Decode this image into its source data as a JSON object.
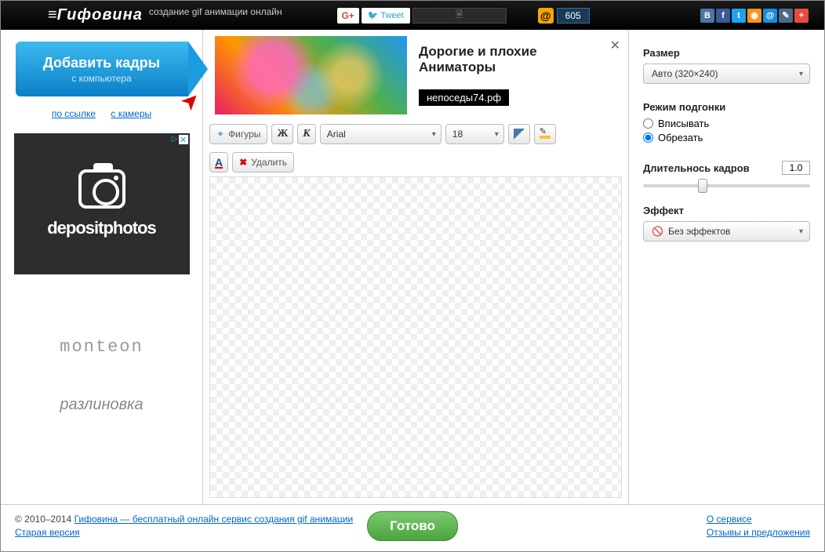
{
  "header": {
    "logo": "Гифовина",
    "tagline": "создание gif анимации онлайн",
    "gplus": "G+",
    "tweet": "Tweet",
    "counter": "605"
  },
  "left": {
    "add_frames_title": "Добавить кадры",
    "add_frames_sub": "с компьютера",
    "link_url": "по ссылке",
    "link_camera": "с камеры",
    "ad_text": "depositphotos",
    "side1": "monteon",
    "side2": "разлиновка"
  },
  "banner": {
    "title": "Дорогие и плохие Аниматоры",
    "url": "непоседы74.рф"
  },
  "toolbar": {
    "shapes": "Фигуры",
    "bold": "Ж",
    "italic": "К",
    "font": "Arial",
    "size": "18",
    "textcolor": "A",
    "delete": "Удалить"
  },
  "controls": {
    "size_label": "Размер",
    "size_value": "Авто (320×240)",
    "fit_label": "Режим подгонки",
    "fit_inscribe": "Вписывать",
    "fit_crop": "Обрезать",
    "duration_label": "Длительнось кадров",
    "duration_value": "1.0",
    "effect_label": "Эффект",
    "effect_value": "Без эффектов"
  },
  "footer": {
    "copyright": "© 2010–2014 ",
    "main_link": "Гифовина — бесплатный онлайн сервис создания gif анимации",
    "old_version": "Старая версия",
    "ready": "Готово",
    "about": "О сервисе",
    "feedback": "Отзывы и предложения"
  }
}
